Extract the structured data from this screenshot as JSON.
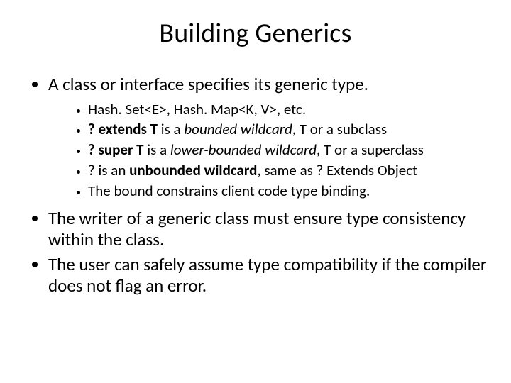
{
  "title": "Building Generics",
  "p1": "A class or interface specifies its generic type.",
  "sub": {
    "a": "Hash. Set<E>, Hash. Map<K, V>, etc.",
    "b1": "? extends T",
    "b2": " is a ",
    "b3": "bounded wildcard",
    "b4": ", T or a subclass",
    "c1": "? super T",
    "c2": " is a ",
    "c3": "lower-bounded wildcard",
    "c4": ", T or a superclass",
    "d1": "? is an ",
    "d2": "unbounded wildcard",
    "d3": ", same as ? Extends Object",
    "e": "The bound constrains client code type binding."
  },
  "p2": "The writer of a generic class must ensure type consistency within the class.",
  "p3": "The user can safely assume type compatibility if the compiler does not flag an error."
}
